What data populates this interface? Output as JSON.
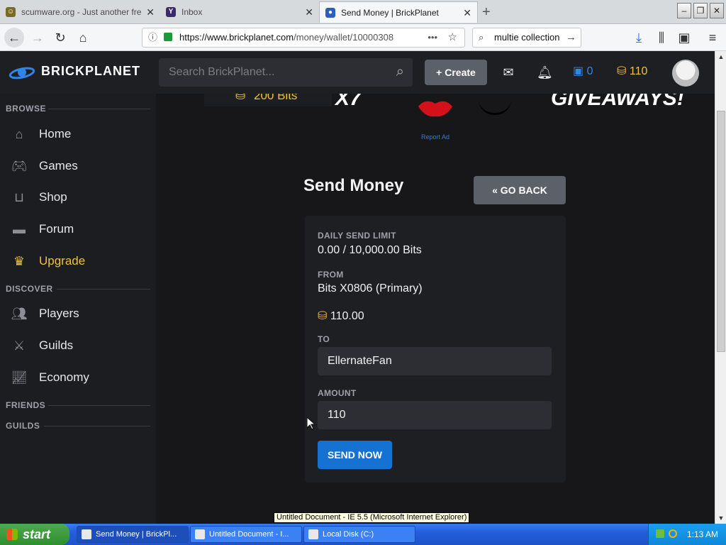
{
  "browser": {
    "tabs": [
      {
        "title": "scumware.org - Just another fre",
        "favicon": "smiley-icon"
      },
      {
        "title": "Inbox",
        "favicon": "yahoo-icon"
      },
      {
        "title": "Send Money | BrickPlanet",
        "favicon": "brickplanet-icon",
        "active": true
      }
    ],
    "url_domain": "https://www.brickplanet.com",
    "url_path": "/money/wallet/10000308",
    "search_text": "multie collection"
  },
  "header": {
    "logo_text": "BRICKPLANET",
    "search_placeholder": "Search BrickPlanet...",
    "create_label": "Create",
    "bucks": "0",
    "bits": "110"
  },
  "sidebar": {
    "browse_label": "BROWSE",
    "browse_items": [
      {
        "label": "Home",
        "icon": "home-icon"
      },
      {
        "label": "Games",
        "icon": "gamepad-icon"
      },
      {
        "label": "Shop",
        "icon": "basket-icon"
      },
      {
        "label": "Forum",
        "icon": "chat-icon"
      },
      {
        "label": "Upgrade",
        "icon": "crown-icon"
      }
    ],
    "discover_label": "DISCOVER",
    "discover_items": [
      {
        "label": "Players",
        "icon": "users-icon"
      },
      {
        "label": "Guilds",
        "icon": "swords-icon"
      },
      {
        "label": "Economy",
        "icon": "chart-icon"
      }
    ],
    "friends_label": "FRIENDS",
    "guilds_label": "GUILDS"
  },
  "ad": {
    "bits_text": "200 Bits",
    "x7_text": "X7",
    "giveaways_text": "GIVEAWAYS!",
    "report_text": "Report Ad"
  },
  "send_money": {
    "title": "Send Money",
    "go_back_label": "GO BACK",
    "daily_limit_label": "DAILY SEND LIMIT",
    "daily_limit_value": "0.00 / 10,000.00 Bits",
    "from_label": "FROM",
    "from_value": "Bits X0806 (Primary)",
    "balance": "110.00",
    "to_label": "TO",
    "to_value": "EllernateFan",
    "amount_label": "AMOUNT",
    "amount_value": "110",
    "send_label": "SEND NOW"
  },
  "tooltip": "Untitled Document - IE 5.5 (Microsoft Internet Explorer)",
  "taskbar": {
    "start_label": "start",
    "items": [
      {
        "label": "Send Money | BrickPl..."
      },
      {
        "label": "Untitled Document - I..."
      },
      {
        "label": "Local Disk (C:)"
      }
    ],
    "clock": "1:13 AM"
  },
  "colors": {
    "accent_blue": "#1572d3",
    "gold": "#f0c13a",
    "bg": "#17171a"
  }
}
